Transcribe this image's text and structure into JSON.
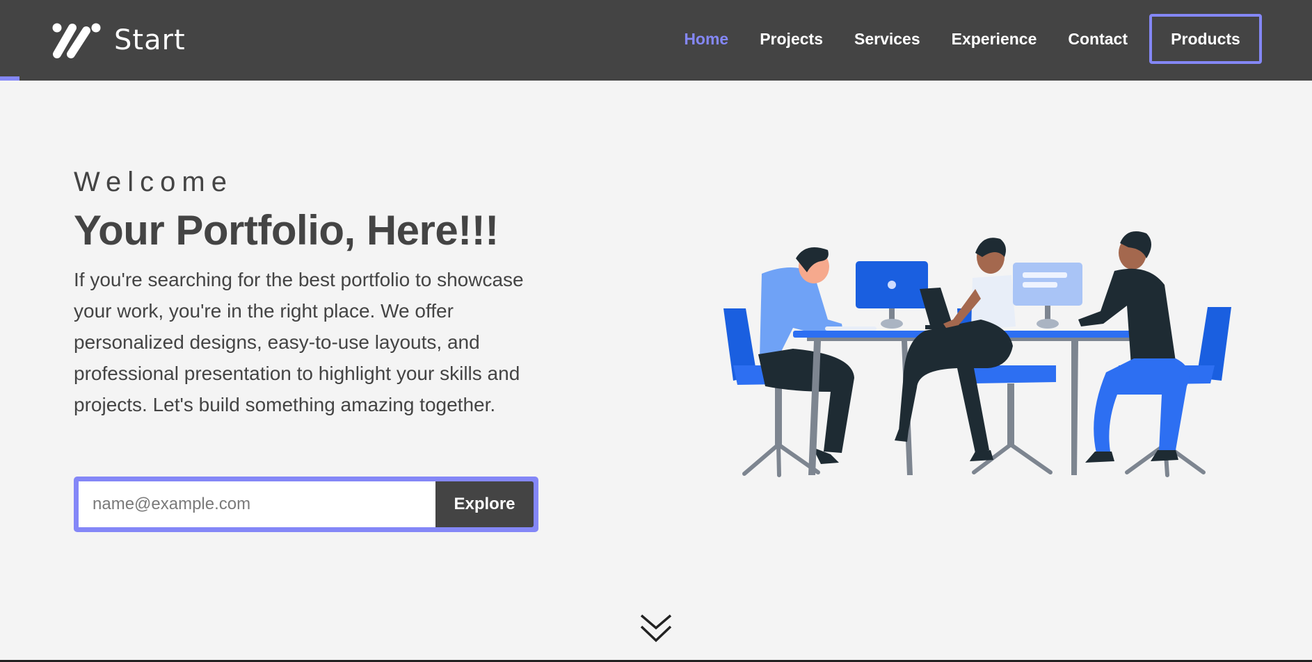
{
  "brand": {
    "name": "Start",
    "logo_icon": "slash-dots-logo-icon"
  },
  "nav": {
    "links": [
      {
        "label": "Home",
        "active": true
      },
      {
        "label": "Projects",
        "active": false
      },
      {
        "label": "Services",
        "active": false
      },
      {
        "label": "Experience",
        "active": false
      },
      {
        "label": "Contact",
        "active": false
      }
    ],
    "cta_label": "Products"
  },
  "scroll_progress": 0.015,
  "hero": {
    "eyebrow": "Welcome",
    "title": "Your Portfolio, Here!!!",
    "description": "If you're searching for the best portfolio to showcase your work, you're in the right place. We offer personalized designs, easy-to-use layouts, and professional presentation to highlight your skills and projects. Let's build something amazing together."
  },
  "signup": {
    "placeholder": "name@example.com",
    "value": "",
    "button_label": "Explore"
  },
  "illustration": {
    "icon": "team-working-at-desk-illustration"
  },
  "scroll_icon": "double-chevron-down-icon",
  "colors": {
    "accent": "#8487f7",
    "navbar": "#444444",
    "background": "#f4f4f4",
    "text": "#444444",
    "illustration_blue": "#1a5fe0"
  }
}
